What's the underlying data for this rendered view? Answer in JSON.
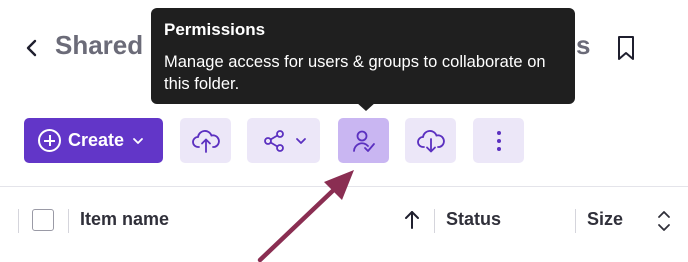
{
  "header": {
    "title": "Shared",
    "title_tail": "s"
  },
  "tooltip": {
    "title": "Permissions",
    "body": "Manage access for users & groups to collaborate on this folder."
  },
  "toolbar": {
    "create_label": "Create"
  },
  "table": {
    "columns": {
      "item_name": "Item name",
      "status": "Status",
      "size": "Size"
    }
  },
  "colors": {
    "primary": "#6236c8",
    "tool_bg": "#ece7f8",
    "tool_active_bg": "#c9b6f2",
    "icon": "#5b30c0",
    "annotation_arrow": "#8a2e52",
    "tooltip_bg": "#1f1f1f"
  },
  "icons": [
    "back-icon",
    "bookmark-icon",
    "plus-circle-icon",
    "chevron-down-icon",
    "upload-cloud-icon",
    "share-icon",
    "user-check-icon",
    "download-cloud-icon",
    "more-vertical-icon",
    "sort-arrow-up-icon",
    "sort-both-icon"
  ]
}
